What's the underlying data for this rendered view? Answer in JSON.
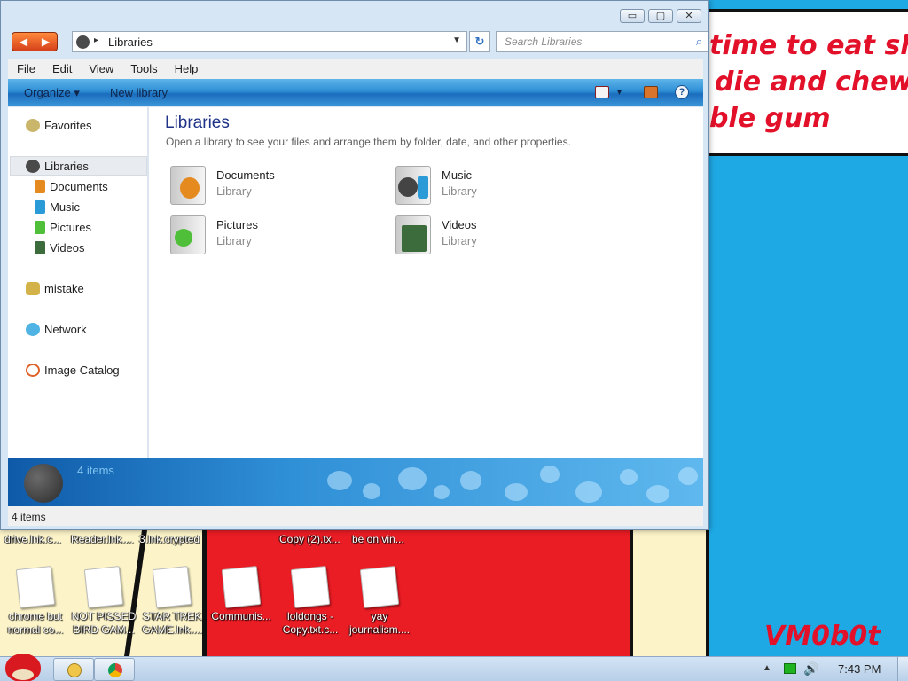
{
  "wallpaper": {
    "speech_lines": [
      "time to eat shit",
      "die and chew",
      "ble gum"
    ],
    "signature": "VM0b0t"
  },
  "desktop": {
    "top_row_labels": [
      "drive.lnk.c...",
      "Reader.lnk....",
      "3.lnk.crypted",
      "Copy (2).tx...",
      "be on vin..."
    ],
    "icons": [
      {
        "label": "chrome but normal co..."
      },
      {
        "label": "NOT PISSED BIRD GAM..."
      },
      {
        "label": "STAR TREK GAME.lnk...."
      },
      {
        "label": "Communis..."
      },
      {
        "label": "loldongs - Copy.txt.c..."
      },
      {
        "label": "yay journalism...."
      }
    ]
  },
  "window": {
    "caption_buttons": {
      "minimize": "▭",
      "maximize": "▢",
      "close": "✕"
    },
    "nav": {
      "back": "◀",
      "forward": "▶"
    },
    "address": {
      "location": "Libraries",
      "separator": "▸",
      "dropdown": "▼"
    },
    "refresh_icon": "↻",
    "search": {
      "placeholder": "Search Libraries",
      "icon": "⌕"
    },
    "menu": [
      "File",
      "Edit",
      "View",
      "Tools",
      "Help"
    ],
    "command_bar": {
      "organize": "Organize ▾",
      "new_library": "New library",
      "view_dropdown": "▾",
      "help": "?"
    },
    "sidebar": {
      "favorites": "Favorites",
      "libraries": "Libraries",
      "library_items": [
        "Documents",
        "Music",
        "Pictures",
        "Videos"
      ],
      "homegroup": "mistake",
      "network": "Network",
      "catalog": "Image Catalog"
    },
    "content": {
      "title": "Libraries",
      "subtitle": "Open a library to see your files and arrange them by folder, date, and other properties.",
      "libraries": [
        {
          "name": "Documents",
          "kind": "Library",
          "accent": "#e58a1f"
        },
        {
          "name": "Music",
          "kind": "Library",
          "accent": "#2b9bd8"
        },
        {
          "name": "Pictures",
          "kind": "Library",
          "accent": "#4fbf3a"
        },
        {
          "name": "Videos",
          "kind": "Library",
          "accent": "#3c6b3c"
        }
      ]
    },
    "details_count": "4 items",
    "status_text": "4 items"
  },
  "taskbar": {
    "time": "7:43 PM",
    "tray_arrow": "▲",
    "volume_icon": "🔊"
  },
  "colors": {
    "sky": "#1ea8e4",
    "wallpaper_red": "#e3102a",
    "command_bar": "#2d8dd4",
    "title_text": "#1e3287"
  }
}
